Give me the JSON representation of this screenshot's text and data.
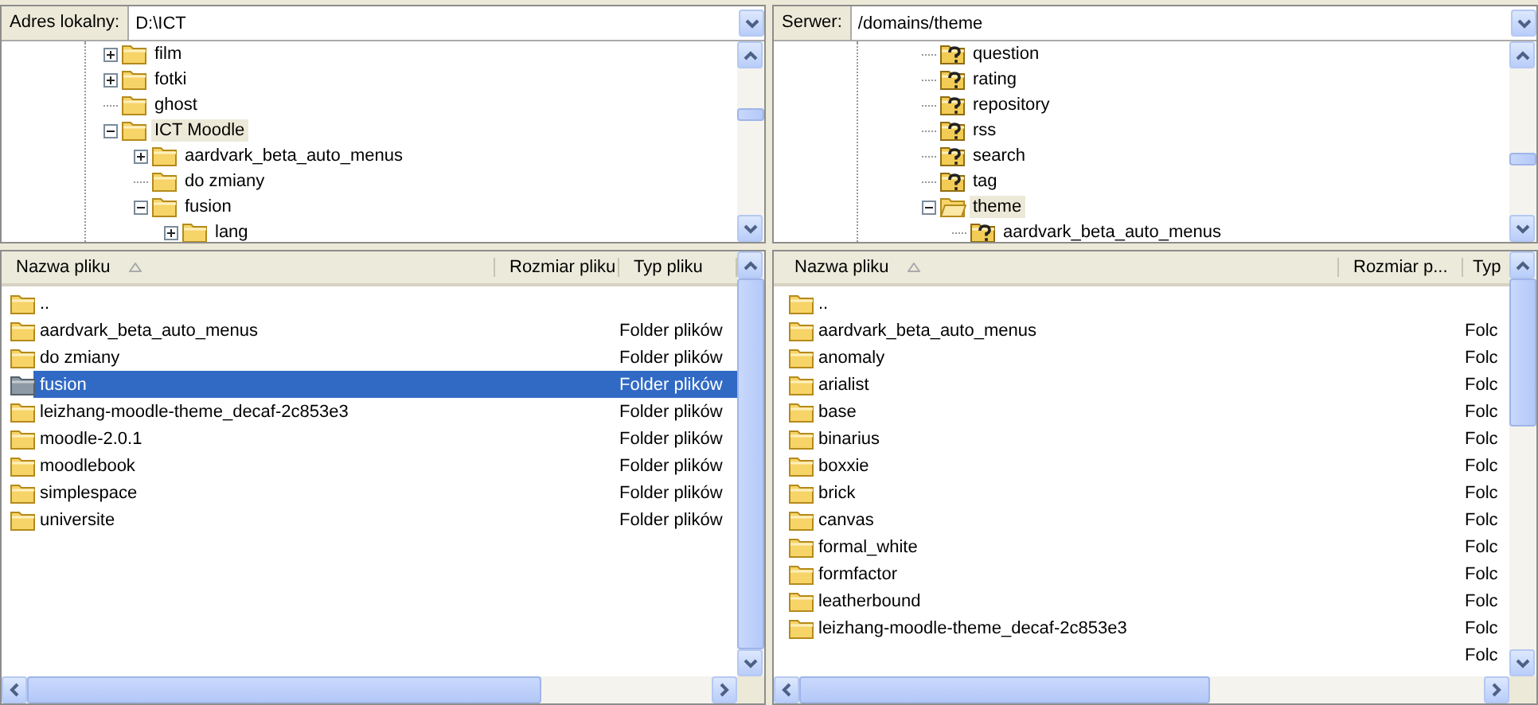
{
  "panes": [
    {
      "address": {
        "label": "Adres lokalny:",
        "value": "D:\\ICT"
      },
      "tree": [
        {
          "label": "film",
          "kind": "folder",
          "expanded": false,
          "selected": false
        },
        {
          "label": "fotki",
          "kind": "folder",
          "expanded": false,
          "selected": false
        },
        {
          "label": "ghost",
          "kind": "folder",
          "selected": false
        },
        {
          "label": "ICT Moodle",
          "kind": "folder",
          "expanded": true,
          "selected": true,
          "children": [
            {
              "label": "aardvark_beta_auto_menus",
              "kind": "folder",
              "expanded": false,
              "selected": false
            },
            {
              "label": "do zmiany",
              "kind": "folder",
              "selected": false
            },
            {
              "label": "fusion",
              "kind": "folder",
              "expanded": true,
              "selected": false,
              "children": [
                {
                  "label": "lang",
                  "kind": "folder",
                  "expanded": false,
                  "selected": false
                }
              ]
            }
          ]
        }
      ],
      "list": {
        "columns": [
          "Nazwa pliku",
          "Rozmiar pliku",
          "Typ pliku"
        ],
        "rows": [
          {
            "name": "..",
            "selected": false
          },
          {
            "name": "aardvark_beta_auto_menus",
            "type": "Folder plików",
            "selected": false
          },
          {
            "name": "do zmiany",
            "type": "Folder plików",
            "selected": false
          },
          {
            "name": "fusion",
            "type": "Folder plików",
            "selected": true
          },
          {
            "name": "leizhang-moodle-theme_decaf-2c853e3",
            "type": "Folder plików",
            "selected": false
          },
          {
            "name": "moodle-2.0.1",
            "type": "Folder plików",
            "selected": false
          },
          {
            "name": "moodlebook",
            "type": "Folder plików",
            "selected": false
          },
          {
            "name": "simplespace",
            "type": "Folder plików",
            "selected": false
          },
          {
            "name": "universite",
            "type": "Folder plików",
            "selected": false
          }
        ]
      }
    },
    {
      "address": {
        "label": "Serwer:",
        "value": "/domains/theme"
      },
      "tree": [
        {
          "label": "question",
          "kind": "unknown",
          "selected": false
        },
        {
          "label": "rating",
          "kind": "unknown",
          "selected": false
        },
        {
          "label": "repository",
          "kind": "unknown",
          "selected": false
        },
        {
          "label": "rss",
          "kind": "unknown",
          "selected": false
        },
        {
          "label": "search",
          "kind": "unknown",
          "selected": false
        },
        {
          "label": "tag",
          "kind": "unknown",
          "selected": false
        },
        {
          "label": "theme",
          "kind": "open",
          "expanded": true,
          "selected": true,
          "children": [
            {
              "label": "aardvark_beta_auto_menus",
              "kind": "unknown",
              "selected": false
            }
          ]
        }
      ],
      "list": {
        "columns": [
          "Nazwa pliku",
          "Rozmiar p...",
          "Typ"
        ],
        "rows": [
          {
            "name": "..",
            "selected": false
          },
          {
            "name": "aardvark_beta_auto_menus",
            "type": "Folc",
            "selected": false
          },
          {
            "name": "anomaly",
            "type": "Folc",
            "selected": false
          },
          {
            "name": "arialist",
            "type": "Folc",
            "selected": false
          },
          {
            "name": "base",
            "type": "Folc",
            "selected": false
          },
          {
            "name": "binarius",
            "type": "Folc",
            "selected": false
          },
          {
            "name": "boxxie",
            "type": "Folc",
            "selected": false
          },
          {
            "name": "brick",
            "type": "Folc",
            "selected": false
          },
          {
            "name": "canvas",
            "type": "Folc",
            "selected": false
          },
          {
            "name": "formal_white",
            "type": "Folc",
            "selected": false
          },
          {
            "name": "formfactor",
            "type": "Folc",
            "selected": false
          },
          {
            "name": "leatherbound",
            "type": "Folc",
            "selected": false
          },
          {
            "name": "leizhang-moodle-theme_decaf-2c853e3",
            "type": "Folc",
            "selected": false
          },
          {
            "type": "Folc",
            "selected": false
          }
        ]
      }
    }
  ]
}
